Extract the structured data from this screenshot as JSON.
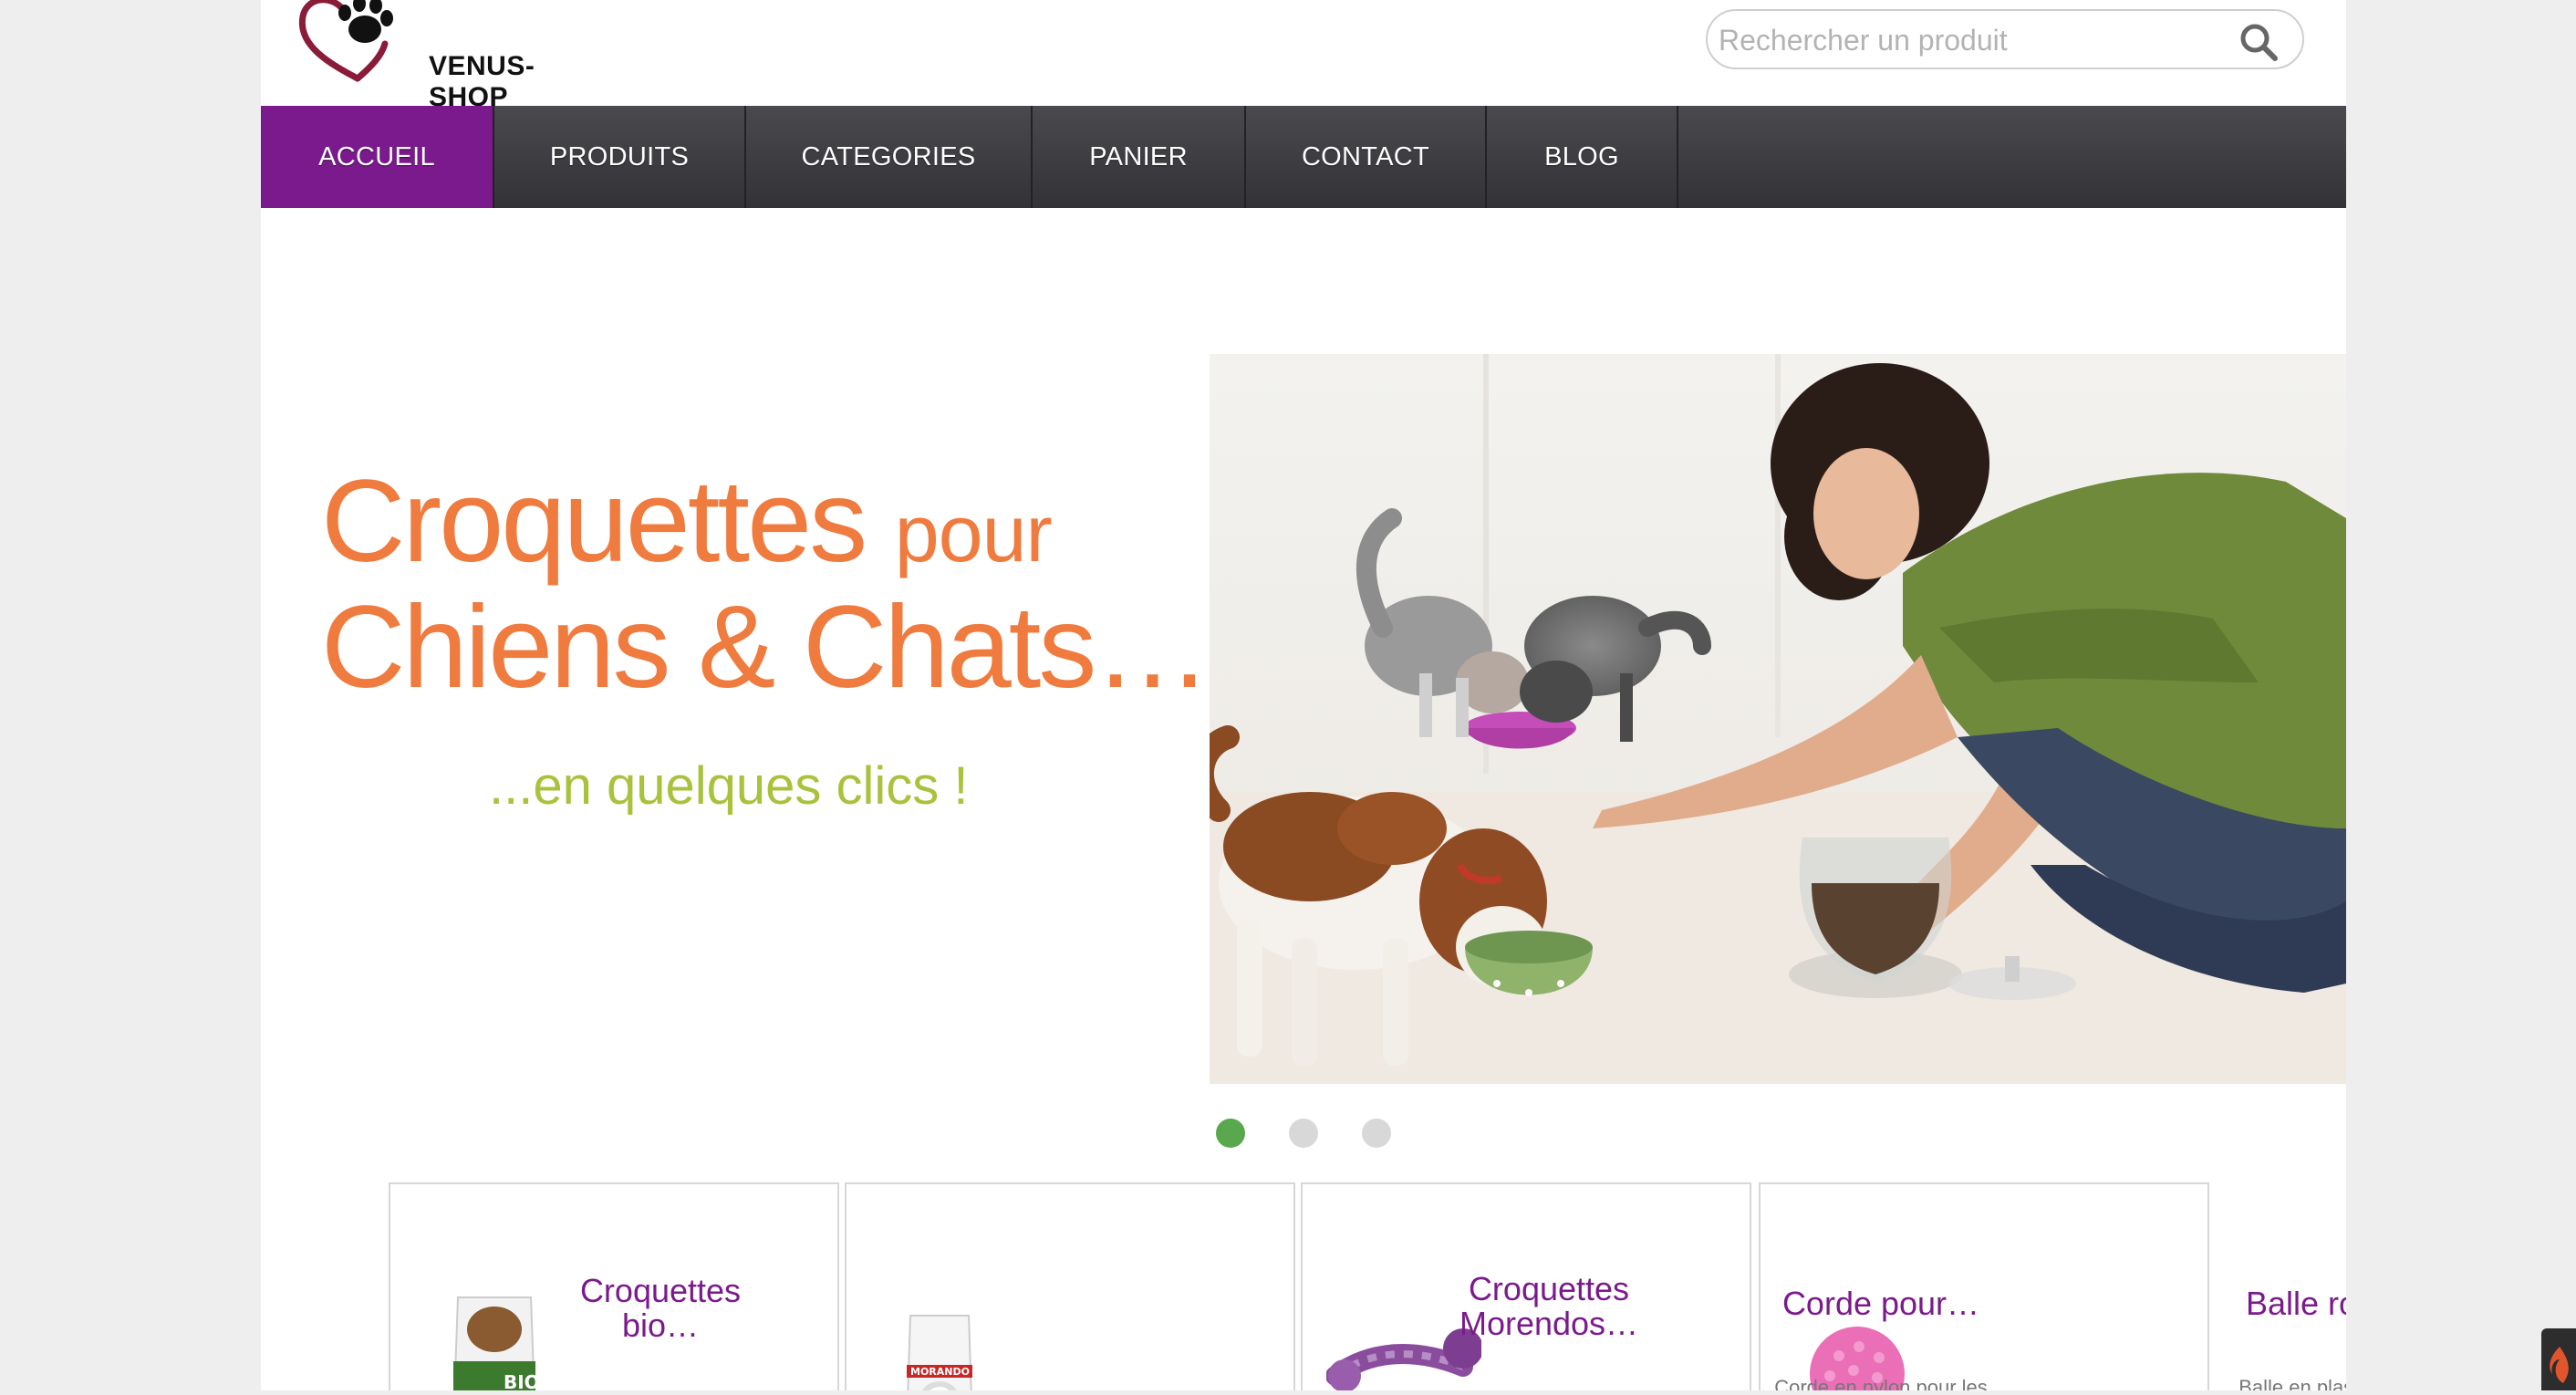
{
  "brand": {
    "name": "VENUS-SHOP",
    "accent": "#7b1a8c"
  },
  "search": {
    "placeholder": "Rechercher un produit",
    "icon": "search-icon"
  },
  "nav": {
    "items": [
      {
        "label": "ACCUEIL",
        "active": true
      },
      {
        "label": "PRODUITS"
      },
      {
        "label": "CATEGORIES"
      },
      {
        "label": "PANIER"
      },
      {
        "label": "CONTACT"
      },
      {
        "label": "BLOG"
      }
    ]
  },
  "slider": {
    "headline_line1_big": "Croquettes",
    "headline_line1_small": "pour",
    "headline_line2": "Chiens & Chats…",
    "tagline": "...en quelques clics !",
    "active_slide": 1,
    "slide_count": 3
  },
  "products": [
    {
      "title_line1": "Croquettes",
      "title_line2": "bio…",
      "desc": ""
    },
    {
      "title_line1": "Croquettes",
      "title_line2": "Morendos…",
      "desc": ""
    },
    {
      "title_line1": "Corde pour…",
      "title_line2": "",
      "desc": "Corde en nylon pour les"
    },
    {
      "title_line1": "Balle rose…",
      "title_line2": "",
      "desc": "Balle en plastique dur"
    }
  ],
  "product_package_labels": {
    "bio": "BIO",
    "morando": "MORANDO"
  }
}
